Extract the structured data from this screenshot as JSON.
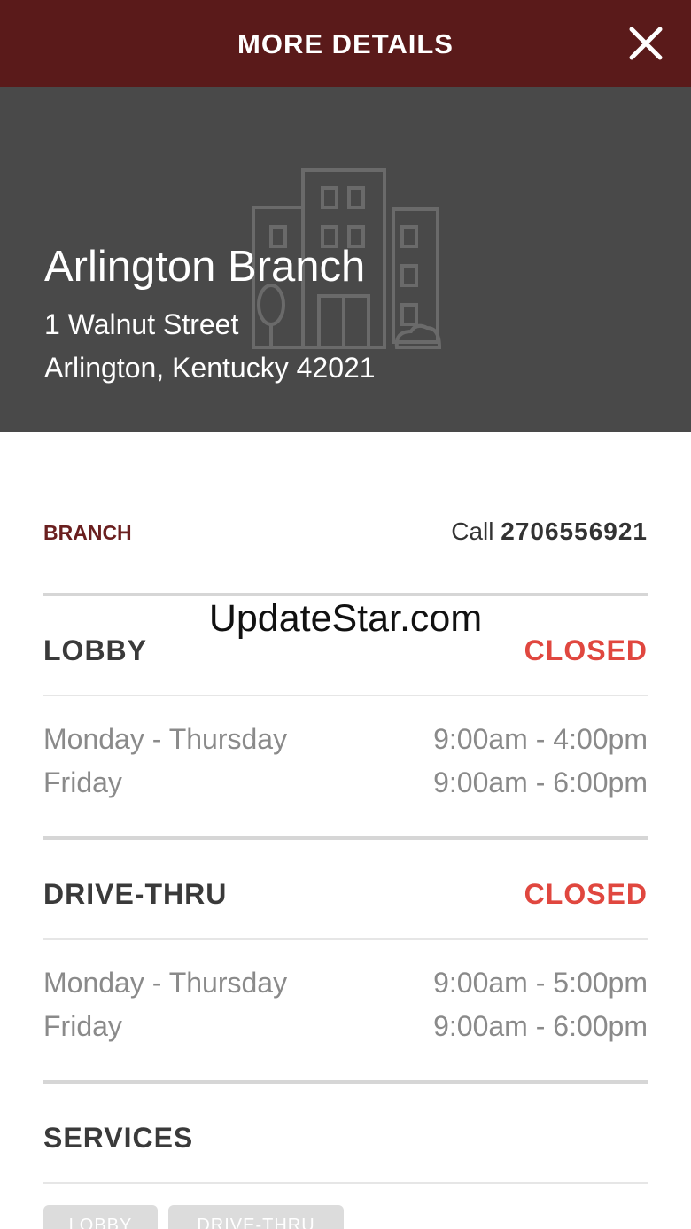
{
  "header": {
    "title": "MORE DETAILS",
    "close_icon": "close-icon"
  },
  "branch": {
    "name": "Arlington Branch",
    "street": "1 Walnut Street",
    "city_line": "Arlington, Kentucky 42021",
    "background_icon": "building-icon"
  },
  "contact": {
    "label": "BRANCH",
    "call_prefix": "Call",
    "phone": "2706556921"
  },
  "lobby": {
    "title": "LOBBY",
    "status": "CLOSED",
    "hours": [
      {
        "days": "Monday - Thursday",
        "time": "9:00am - 4:00pm"
      },
      {
        "days": "Friday",
        "time": "9:00am - 6:00pm"
      }
    ]
  },
  "drive_thru": {
    "title": "DRIVE-THRU",
    "status": "CLOSED",
    "hours": [
      {
        "days": "Monday - Thursday",
        "time": "9:00am - 5:00pm"
      },
      {
        "days": "Friday",
        "time": "9:00am - 6:00pm"
      }
    ]
  },
  "services": {
    "title": "SERVICES",
    "chips": [
      "LOBBY",
      "DRIVE-THRU"
    ]
  },
  "watermark": "UpdateStar.com",
  "colors": {
    "header_bg": "#5a1a1a",
    "hero_bg": "#494949",
    "accent": "#6a1f1f",
    "closed": "#e0473f"
  }
}
